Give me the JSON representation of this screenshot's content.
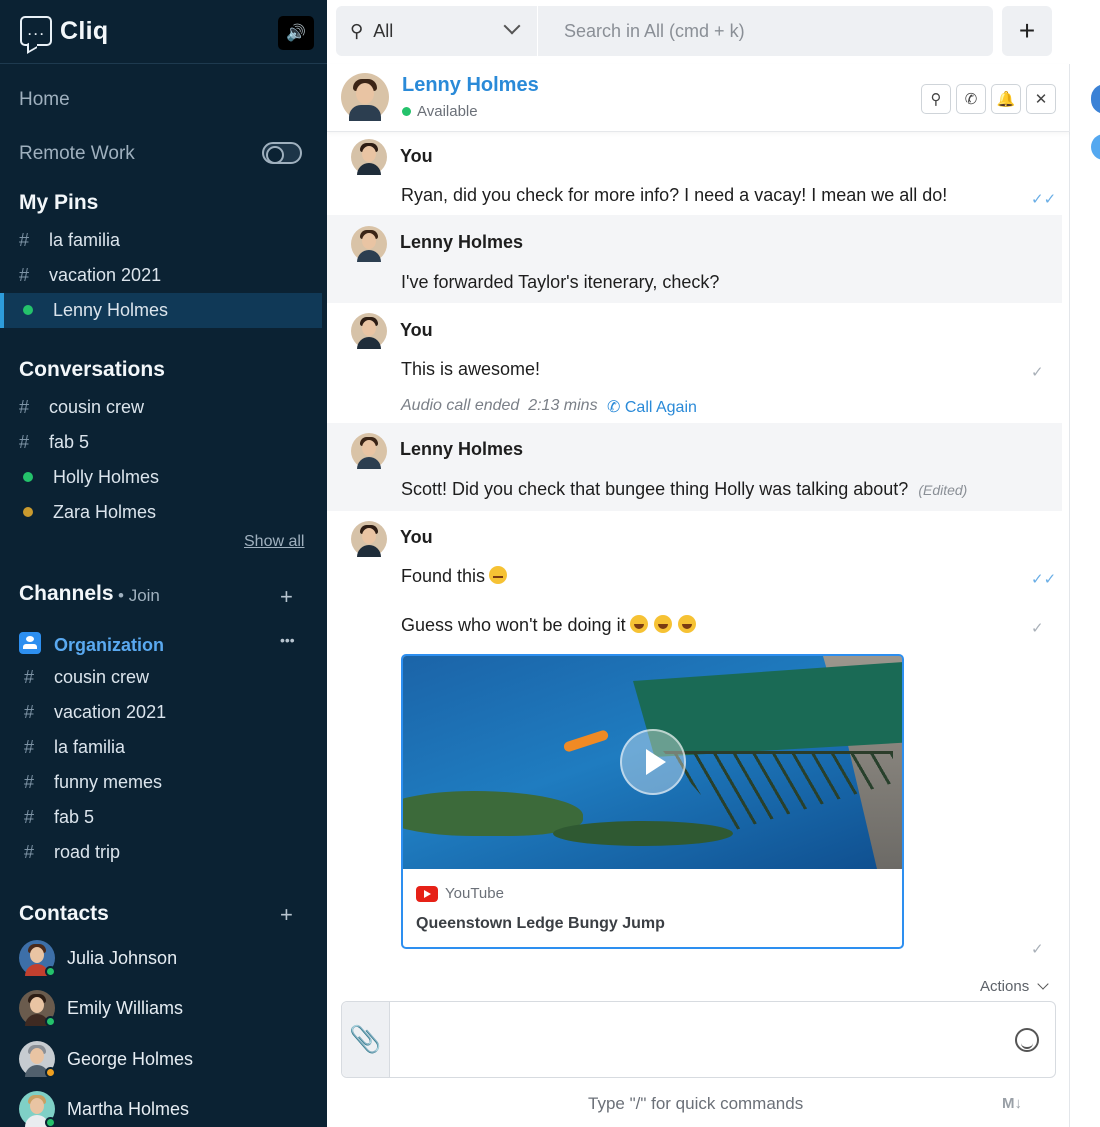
{
  "app": {
    "name": "Cliq",
    "speaker_icon": "speaker-icon"
  },
  "sidebar": {
    "home": "Home",
    "remote_work": "Remote Work",
    "pins_title": "My Pins",
    "pins": [
      {
        "label": "la familia",
        "kind": "channel"
      },
      {
        "label": "vacation 2021",
        "kind": "channel"
      },
      {
        "label": "Lenny Holmes",
        "kind": "user",
        "status_color": "#24c26b"
      }
    ],
    "conversations_title": "Conversations",
    "conversations": [
      {
        "label": "cousin crew",
        "kind": "channel"
      },
      {
        "label": "fab 5",
        "kind": "channel"
      },
      {
        "label": "Holly Holmes",
        "kind": "user",
        "status_color": "#24c26b"
      },
      {
        "label": "Zara Holmes",
        "kind": "user",
        "status_color": "#c99a2e"
      }
    ],
    "show_all": "Show all",
    "channels_title": "Channels",
    "join": "Join",
    "organization": "Organization",
    "more": "•••",
    "channels": [
      "cousin crew",
      "vacation 2021",
      "la familia",
      "funny memes",
      "fab 5",
      "road trip"
    ],
    "contacts_title": "Contacts",
    "contacts": [
      {
        "name": "Julia Johnson",
        "status_color": "#24c26b"
      },
      {
        "name": "Emily Williams",
        "status_color": "#24c26b"
      },
      {
        "name": "George Holmes",
        "status_color": "#f0a020"
      },
      {
        "name": "Martha Holmes",
        "status_color": "#24c26b"
      }
    ]
  },
  "topbar": {
    "scope": "All",
    "search_placeholder": "Search in All (cmd + k)",
    "add": "+"
  },
  "chat": {
    "contact_name": "Lenny Holmes",
    "contact_status": "Available",
    "messages": [
      {
        "author": "You",
        "text": "Ryan, did you check for more info? I need a vacay! I mean we all do!",
        "receipt": "read"
      },
      {
        "author": "Lenny Holmes",
        "text": "I've forwarded Taylor's itenerary, check?"
      },
      {
        "author": "You",
        "text": "This is awesome!",
        "receipt": "sent"
      },
      {
        "author": "Lenny Holmes",
        "text": "Scott! Did you check that bungee thing Holly was talking about?",
        "edited": "(Edited)"
      },
      {
        "author": "You",
        "text": "Found this",
        "receipt": "read"
      },
      {
        "author": "You",
        "text": "Guess who won't be doing it",
        "receipt": "sent"
      }
    ],
    "call_ended": "Audio call ended",
    "call_duration": "2:13 mins",
    "call_again": "Call Again",
    "link_card": {
      "source": "YouTube",
      "title": "Queenstown Ledge Bungy Jump"
    },
    "actions": "Actions",
    "composer_hint": "Type \"/\" for quick commands",
    "markdown": "M↓"
  },
  "colors": {
    "sidebar_bg": "#0b2233",
    "accent": "#2a8ad8",
    "online": "#24c26b"
  }
}
